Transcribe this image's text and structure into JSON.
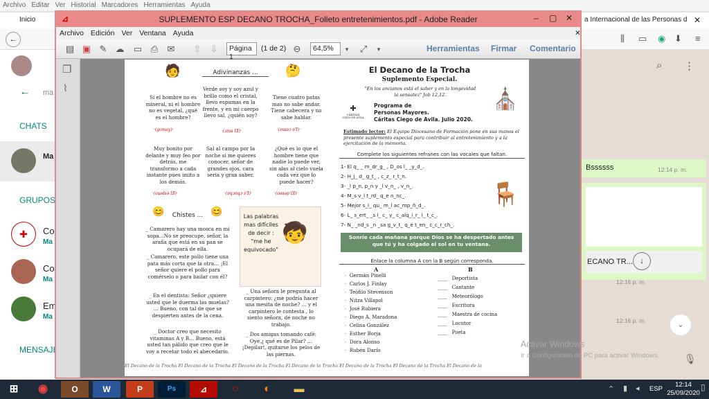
{
  "browser": {
    "menu": [
      "Archivo",
      "Editar",
      "Ver",
      "Historial",
      "Marcadores",
      "Herramientas",
      "Ayuda"
    ],
    "tab_left": "Inicio",
    "tab_right": "a Internacional de las Personas d"
  },
  "whatsapp": {
    "chats_label": "CHATS",
    "groups_label": "GRUPOS",
    "messages_label": "MENSAJE",
    "chat_items": [
      "Ma",
      "Co",
      "Co",
      "Em"
    ],
    "chat_subs": [
      "Ma",
      "Ma",
      "Ma",
      "Ma"
    ],
    "bubble1_text": "Bssssss",
    "bubble1_time": "12:14 p. m.",
    "file_bubble": "ECANO TR...",
    "time2": "12:16 p. m.",
    "time3": "12:16 p. m."
  },
  "reader": {
    "title": "SUPLEMENTO ESP DECANO  TROCHA_Folleto entretenimientos.pdf - Adobe Reader",
    "menu": [
      "Archivo",
      "Edición",
      "Ver",
      "Ventana",
      "Ayuda"
    ],
    "page_value": "Página 1",
    "page_count": "(1 de 2)",
    "zoom": "64,5%",
    "tools": "Herramientas",
    "sign": "Firmar",
    "comment": "Comentario"
  },
  "pdf": {
    "adivinanzas_title": "Adivinanzas ...",
    "riddles": [
      {
        "text": "Si el hombre no es mineral, ni el hombre no es vegetal, ¿qué es el  hombre?",
        "src": "·(gomay)·"
      },
      {
        "text": "Verde soy y soy azul y brillo como el  cristal, llevo espumas en la frente, y en mi cuerpo llevo sal, ¿quién soy?",
        "src": "·(ɹɐɯ lƎ)·"
      },
      {
        "text": "Tiene cuatro patas mas no sabe andar. Tiene cabecera y no sabe hablar.",
        "src": "·(ɐɯɐɔ ɐꞀ)·"
      },
      {
        "text": "Muy bonito por delante y muy feo por detrás, me transformo a cada instante pues imito a los demás.",
        "src": "·(oʇǝdsǝ lƎ)·"
      },
      {
        "text": "Sal al campo por la noche si me quieres conocer, señor de grandes ojos, cara seria y gran saber.",
        "src": "·(ɐɥɔnɥɔ ɐꞀ)·"
      },
      {
        "text": "¿Qué es lo que el hombre tiene que nadie lo puede ver, sin alas al cielo vuela cada vez que lo puede hacer?",
        "src": "·(oǝsǝp lƎ)·"
      }
    ],
    "chistes_title": "Chistes ...",
    "jokes": [
      "_ Camarero hay una mosca en mi sopa…No se preocupe, señor, la araña que está en su pan se ocupará de ella.",
      "_ Camarero, este pollo tiene una pata más corta que la otra… ¡El señor quiere el pollo para comérselo o para bailar con él?",
      "_ En el dentista: Señor ¿quiere usted que le duerma las muelas? … Bueno, con tal de que se despierten antes de la cena.",
      "_ Doctor creo que necesito vitaminas A y B… Bueno, está usted tan pálido que creo que le voy a recetar todo el abecedario."
    ],
    "quote_bubble": "Las palabras mas difíciles de decir : \"me he equivocado\"",
    "jokes2": [
      "_ Una señora le pregunta al carpintero: ¿me podría hacer una mesita de noche? … y el carpintero le contesta , lo siento señora, de noche no trabajo.",
      "_ Dos amigas tomando café: Oye,¿ qué es de Pilar? … ¡Depilar!, quitarse los pelos de las  piernas."
    ],
    "footer": "El Decano de la Trocha El Decano de la Trocha El Decano de la Trocha El Decano de la Trocha El Decano de la Trocha El Decano de la Trocha El Decano de la",
    "masthead": "El Decano de la Trocha",
    "supplement": "Suplemento Especial.",
    "quote": "\"En los ancianos está el saber y en la longevidad  la sensatez\" Job 12,12.",
    "caritas_label": "CÁRITAS",
    "caritas_sub": "CIEGO DE ÁVILA",
    "program": [
      "Programa de",
      "Personas Mayores.",
      "Cáritas Ciego de Avila. Julio 2020."
    ],
    "reader_label": "Estimado lector:",
    "reader_text": "El Equipo Diocesano de Formación pone en sus manos el presente suplemento especial para contribuir al entretenimiento y a la ejercitación de la memoria.",
    "refranes_title": "Complete los siguientes refranes con las vocales que faltan.",
    "refranes": [
      "1-  El  q_ _ m_dr_g_ , D_os  l_  _y_d_.",
      "2-  H_j_ d_  g_t_ , c_z_  r_t_n.",
      "3-  _l p_n, p_n y _l v_n_ , v_n_.",
      "4-  M_s v_l  t_rd_  q_e n_nc_.",
      "5-  Mejor s_l_  qu_  m_l  ac_mp_ñ_d_.",
      "6-  L_ s_ert_  _s l_ c_ y_  c_alq_i_r_  l_ t_c_.",
      "7-  N_ _nd_s  _n  _sa  g_v_t_  q_e  t_en_  c_c_r_ch_."
    ],
    "banner": "Sonríe cada mañana porque Dios se ha despertado antes que tú y ha colgado el sol en tu ventana.",
    "match_title": "Enlace la columna A con la B según corresponda.",
    "col_a_head": "A",
    "col_b_head": "B",
    "col_a": [
      "Germán  Pinelli",
      "Carlos J. Finlay",
      "Teófilo Stevenson",
      "Nitza Villapol",
      "José Rubiera",
      "Diego A. Maradona",
      "Celina González",
      "Esther Borja",
      "Dora Alonso",
      "Rubén Darío"
    ],
    "col_b": [
      "Deportista",
      "Cantante",
      "Meteorólogo",
      "Escritora",
      "Maestra de cocina",
      "Locutor",
      "Poeta"
    ]
  },
  "windows": {
    "watermark1": "Activar Windows",
    "watermark2": "Ir a Configuración de PC para activar Windows.",
    "lang": "ESP",
    "time": "12:14",
    "date": "25/09/2020"
  },
  "colors": {
    "title_bar": "#e9898a",
    "banner": "#6b8e6b",
    "taskbar": "#1e2a38",
    "accent": "#5b7fa6"
  }
}
